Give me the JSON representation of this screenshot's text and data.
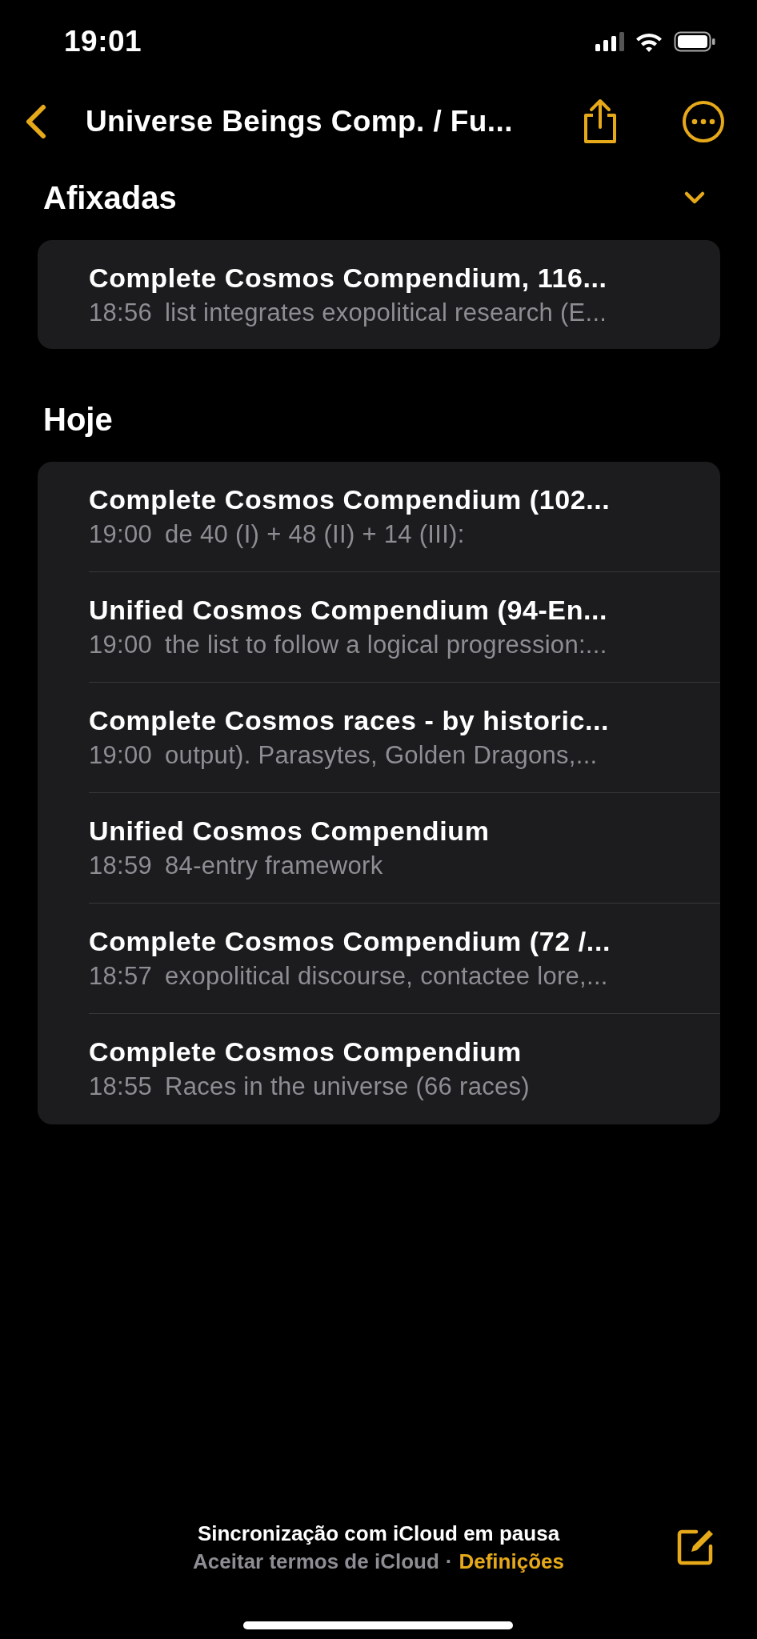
{
  "status_bar": {
    "time": "19:01"
  },
  "nav_bar": {
    "title": "Universe Beings Comp. / Fu..."
  },
  "sections": [
    {
      "title": "Afixadas",
      "collapse_toggle": true,
      "notes": [
        {
          "title": "Complete Cosmos Compendium, 116...",
          "time": "18:56",
          "preview": "list integrates exopolitical research (E..."
        }
      ]
    },
    {
      "title": "Hoje",
      "collapse_toggle": false,
      "notes": [
        {
          "title": "Complete Cosmos Compendium (102...",
          "time": "19:00",
          "preview": "de 40 (I) + 48 (II) + 14 (III):"
        },
        {
          "title": "Unified Cosmos Compendium (94-En...",
          "time": "19:00",
          "preview": "the list to follow a logical progression:..."
        },
        {
          "title": "Complete Cosmos races - by historic...",
          "time": "19:00",
          "preview": "output). Parasytes, Golden Dragons,..."
        },
        {
          "title": "Unified Cosmos Compendium",
          "time": "18:59",
          "preview": "84-entry framework"
        },
        {
          "title": "Complete Cosmos Compendium (72 /...",
          "time": "18:57",
          "preview": "exopolitical discourse, contactee lore,..."
        },
        {
          "title": "Complete Cosmos Compendium",
          "time": "18:55",
          "preview": "Races in the universe (66 races)"
        }
      ]
    }
  ],
  "footer": {
    "status": "Sincronização com iCloud em pausa",
    "notice": "Aceitar termos de iCloud",
    "separator": "·",
    "link": "Definições"
  }
}
